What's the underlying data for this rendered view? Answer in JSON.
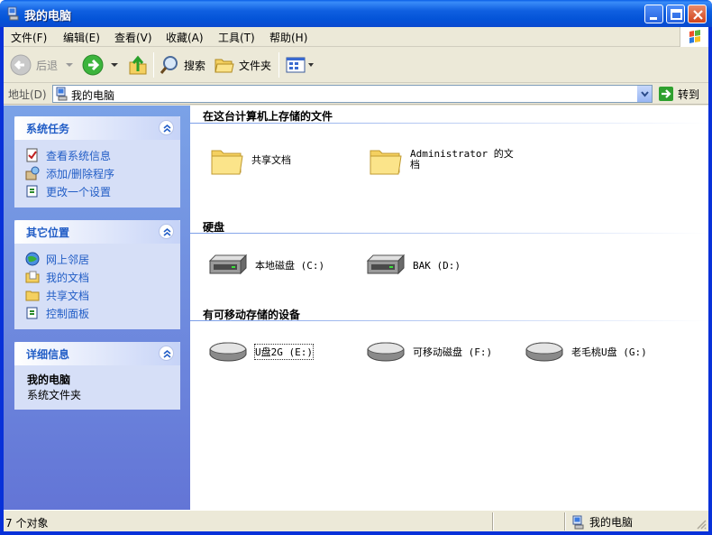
{
  "window": {
    "title": "我的电脑"
  },
  "menu": [
    "文件(F)",
    "编辑(E)",
    "查看(V)",
    "收藏(A)",
    "工具(T)",
    "帮助(H)"
  ],
  "toolbar": {
    "back": "后退",
    "search": "搜索",
    "folders": "文件夹"
  },
  "address": {
    "label": "地址(D)",
    "value": "我的电脑",
    "go": "转到"
  },
  "panels": {
    "system_tasks": {
      "title": "系统任务",
      "items": [
        "查看系统信息",
        "添加/删除程序",
        "更改一个设置"
      ]
    },
    "other_places": {
      "title": "其它位置",
      "items": [
        "网上邻居",
        "我的文档",
        "共享文档",
        "控制面板"
      ]
    },
    "details": {
      "title": "详细信息",
      "name": "我的电脑",
      "type": "系统文件夹"
    }
  },
  "groups": {
    "files": {
      "title": "在这台计算机上存储的文件",
      "items": [
        "共享文档",
        "Administrator 的文",
        "档"
      ]
    },
    "drives": {
      "title": "硬盘",
      "items": [
        "本地磁盘 (C:)",
        "BAK (D:)"
      ]
    },
    "removable": {
      "title": "有可移动存储的设备",
      "items": [
        "U盘2G (E:)",
        "可移动磁盘 (F:)",
        "老毛桃U盘 (G:)"
      ]
    }
  },
  "status": {
    "count": "7 个对象",
    "location": "我的电脑"
  },
  "colors": {
    "titlebar": "#0a5fe8",
    "task_link": "#215dc6",
    "left_pane": "#7ba2e7"
  }
}
